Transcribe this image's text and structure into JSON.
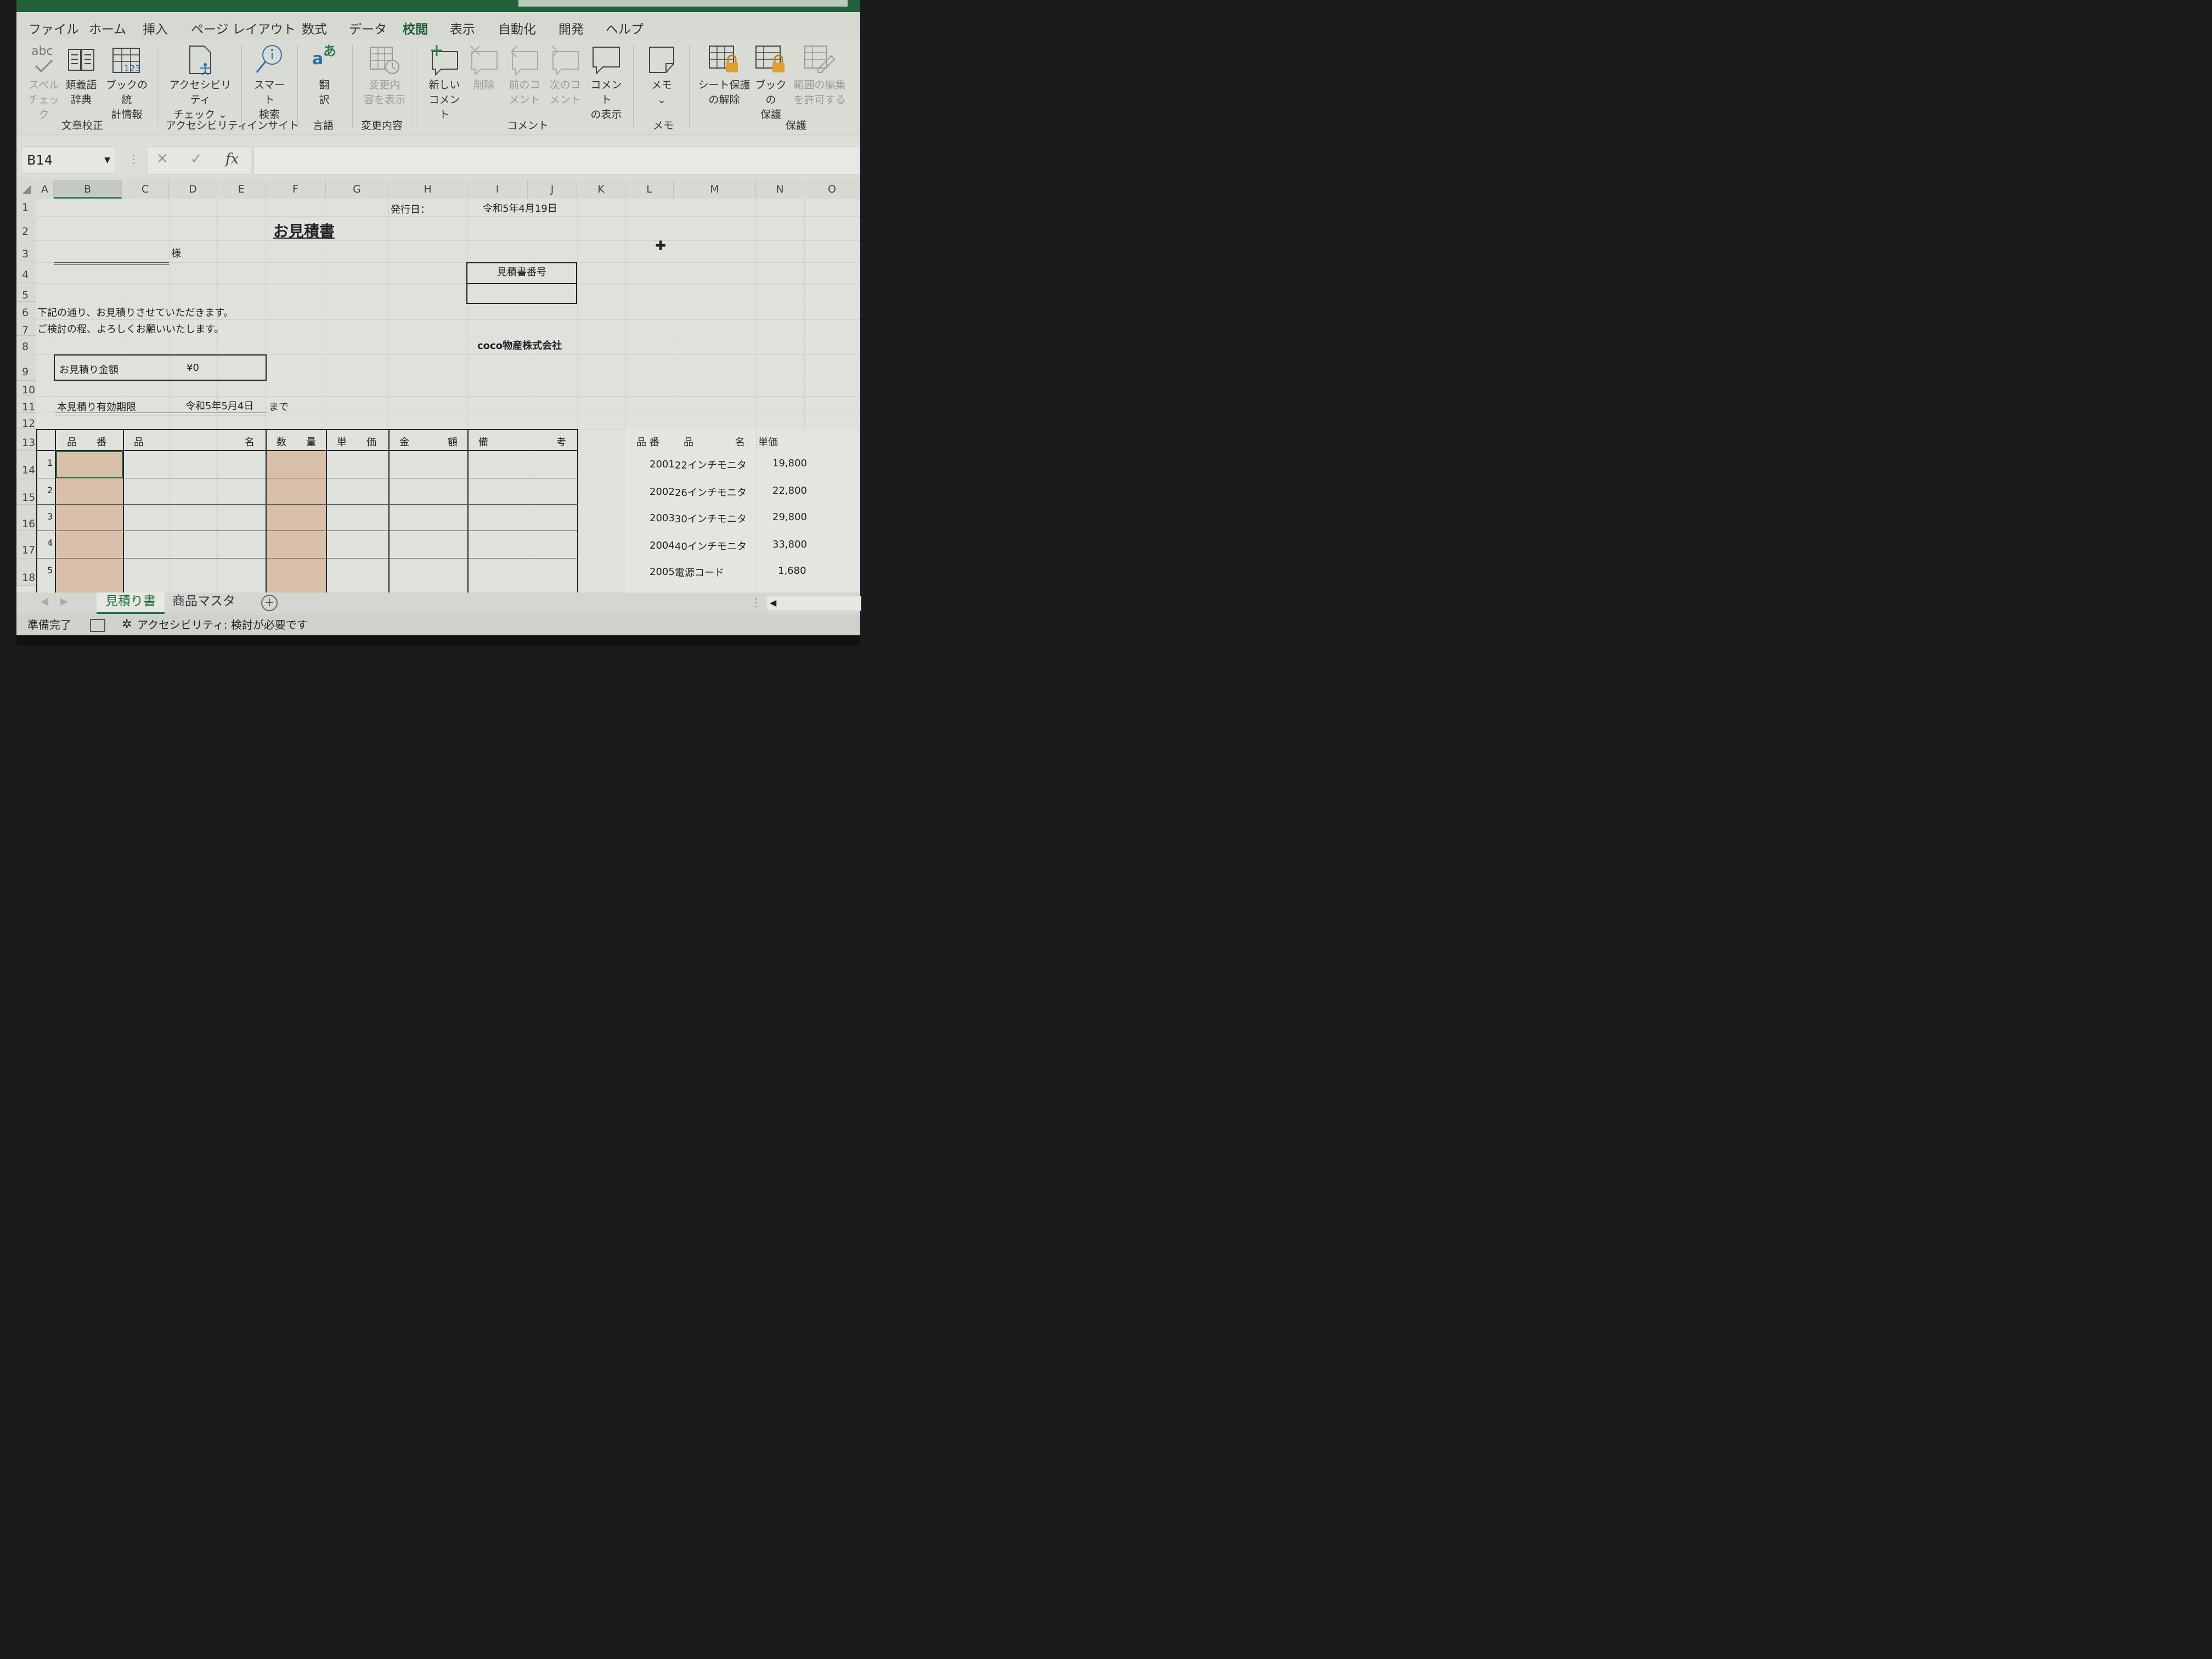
{
  "ribbon_tabs": [
    "ファイル",
    "ホーム",
    "挿入",
    "ページ レイアウト",
    "数式",
    "データ",
    "校閲",
    "表示",
    "自動化",
    "開発",
    "ヘルプ"
  ],
  "active_tab": "校閲",
  "ribbon": {
    "spell": [
      "スペル",
      "チェック"
    ],
    "thesaurus": [
      "類義語",
      "辞典"
    ],
    "stats": [
      "ブックの統",
      "計情報"
    ],
    "group_proofing": "文章校正",
    "access": [
      "アクセシビリティ",
      "チェック ⌄"
    ],
    "group_access": "アクセシビリティ",
    "smart": [
      "スマート",
      "検索"
    ],
    "group_insight": "インサイト",
    "translate": [
      "翻",
      "訳"
    ],
    "group_lang": "言語",
    "showchanges": [
      "変更内",
      "容を表示"
    ],
    "group_changes": "変更内容",
    "newcomment": [
      "新しい",
      "コメント"
    ],
    "delete": [
      "削除"
    ],
    "prev": [
      "前のコ",
      "メント"
    ],
    "next": [
      "次のコ",
      "メント"
    ],
    "showcomments": [
      "コメント",
      "の表示"
    ],
    "group_comment": "コメント",
    "memo": [
      "メモ",
      "⌄"
    ],
    "group_memo": "メモ",
    "unprotect": [
      "シート保護",
      "の解除"
    ],
    "protectbook": [
      "ブックの",
      "保護"
    ],
    "allowedit": [
      "範囲の編集",
      "を許可する"
    ],
    "group_protect": "保護",
    "abc": "abc",
    "translate_icon": "あ"
  },
  "namebox": "B14",
  "fx": "fx",
  "columns": [
    "A",
    "B",
    "C",
    "D",
    "E",
    "F",
    "G",
    "H",
    "I",
    "J",
    "K",
    "L",
    "M",
    "N",
    "O"
  ],
  "rows": [
    "1",
    "2",
    "3",
    "4",
    "5",
    "6",
    "7",
    "8",
    "9",
    "10",
    "11",
    "12",
    "13",
    "14",
    "15",
    "16",
    "17",
    "18"
  ],
  "sheet": {
    "issue_label": "発行日：",
    "issue_date": "令和5年4月19日",
    "title": "お見積書",
    "sama": "様",
    "estimate_no_label": "見積書番号",
    "line1": "下記の通り、お見積りさせていただきます。",
    "line2": "ご検討の程、よろしくお願いいたします。",
    "company": "coco物産株式会社",
    "amount_label": "お見積り金額",
    "amount_value": "¥0",
    "valid_label": "本見積り有効期限",
    "valid_date": "令和5年5月4日",
    "made": "まで",
    "headers": [
      "品　　番",
      "品",
      "名",
      "数　　量",
      "単　　価",
      "金",
      "額",
      "備",
      "考"
    ],
    "row_nums": [
      "1",
      "2",
      "3",
      "4",
      "5"
    ]
  },
  "master": {
    "headers": [
      "品 番",
      "品",
      "名",
      "単価"
    ],
    "rows": [
      {
        "code": "2001",
        "name": "22インチモニタ",
        "price": "19,800"
      },
      {
        "code": "2002",
        "name": "26インチモニタ",
        "price": "22,800"
      },
      {
        "code": "2003",
        "name": "30インチモニタ",
        "price": "29,800"
      },
      {
        "code": "2004",
        "name": "40インチモニタ",
        "price": "33,800"
      },
      {
        "code": "2005",
        "name": "電源コード",
        "price": "1,680"
      }
    ]
  },
  "sheet_tabs": [
    "見積り書",
    "商品マスタ"
  ],
  "status": {
    "ready": "準備完了",
    "accessibility": "アクセシビリティ: 検討が必要です"
  },
  "colors": {
    "accent": "#1f6e3b",
    "peach": "#d8bfaa"
  }
}
